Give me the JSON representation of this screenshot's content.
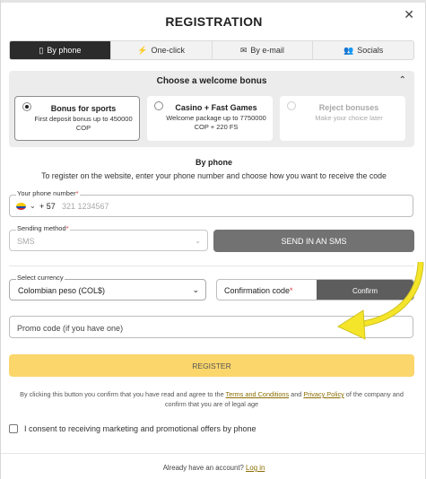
{
  "modal": {
    "title": "REGISTRATION",
    "close_icon": "✕"
  },
  "tabs": [
    {
      "label": "By phone",
      "icon": "phone-icon",
      "glyph": "▯",
      "active": true
    },
    {
      "label": "One-click",
      "icon": "lightning-icon",
      "glyph": "⚡",
      "active": false
    },
    {
      "label": "By e-mail",
      "icon": "envelope-icon",
      "glyph": "✉",
      "active": false
    },
    {
      "label": "Socials",
      "icon": "people-icon",
      "glyph": "👥",
      "active": false
    }
  ],
  "bonus": {
    "heading": "Choose a welcome bonus",
    "cards": [
      {
        "title": "Bonus for sports",
        "desc": "First deposit bonus up to 450000 COP",
        "selected": true
      },
      {
        "title": "Casino + Fast Games",
        "desc": "Welcome package up to 7750000 COP + 220 FS",
        "selected": false
      },
      {
        "title": "Reject bonuses",
        "desc": "Make your choice later",
        "selected": false
      }
    ]
  },
  "method": {
    "heading": "By phone",
    "instructions": "To register on the website, enter your phone number and choose how you want to receive the code"
  },
  "phone": {
    "label": "Your phone number",
    "required_mark": "*",
    "country_code": "+ 57",
    "placeholder": "321 1234567"
  },
  "sending": {
    "label": "Sending method",
    "required_mark": "*",
    "value": "SMS",
    "button": "SEND IN AN SMS"
  },
  "currency": {
    "label": "Select currency",
    "value": "Colombian peso (COL$)"
  },
  "confirmation": {
    "label": "Confirmation code",
    "required_mark": "*",
    "button": "Confirm"
  },
  "promo": {
    "placeholder": "Promo code (if you have one)"
  },
  "register": {
    "button": "REGISTER",
    "terms_before": "By clicking this button you confirm that you have read and agree to the ",
    "terms_link": "Terms and Conditions",
    "terms_and": " and ",
    "privacy_link": "Privacy Policy",
    "terms_after": " of the company and confirm that you are of legal age"
  },
  "consent": {
    "label": "I consent to receiving marketing and promotional offers by phone",
    "checked": false
  },
  "footer": {
    "text": "Already have an account? ",
    "login_link": "Log in"
  },
  "colors": {
    "register_button": "#fbd66b",
    "active_tab": "#2b2b2b",
    "arrow": "#f5e52a"
  }
}
